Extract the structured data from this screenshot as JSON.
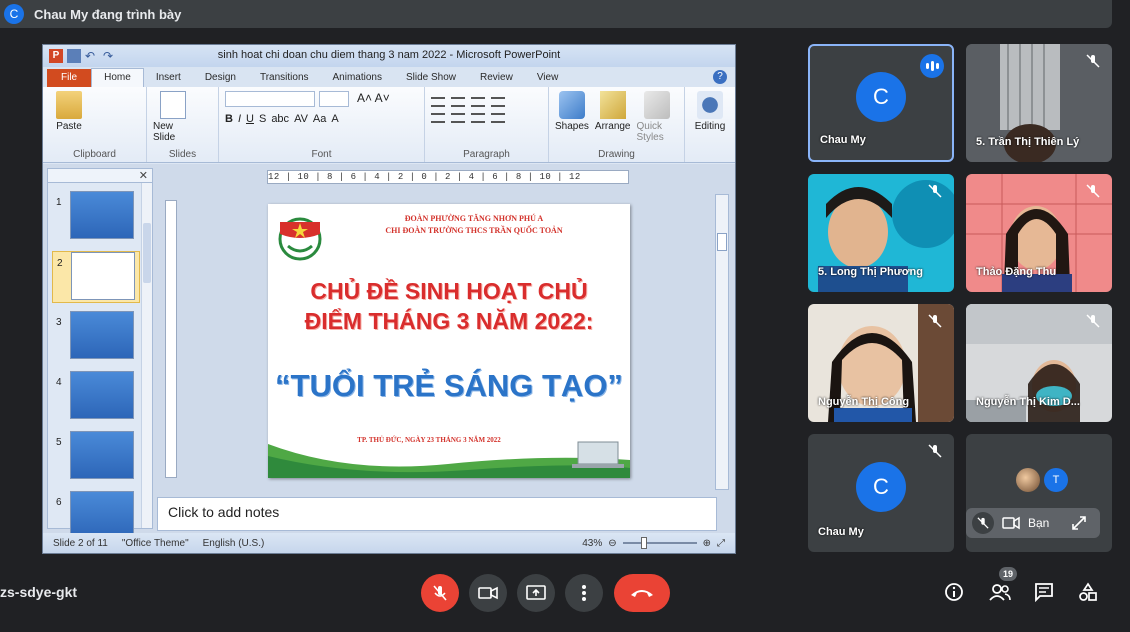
{
  "presenter_bar": {
    "avatar_letter": "C",
    "text": "Chau My đang trình bày"
  },
  "ppt": {
    "window_title": "sinh hoat chi doan chu diem thang 3 nam 2022  -  Microsoft PowerPoint",
    "tabs": [
      "File",
      "Home",
      "Insert",
      "Design",
      "Transitions",
      "Animations",
      "Slide Show",
      "Review",
      "View"
    ],
    "active_tab": "Home",
    "groups": {
      "clipboard": "Clipboard",
      "paste": "Paste",
      "slides": "Slides",
      "new_slide": "New Slide",
      "font": "Font",
      "paragraph": "Paragraph",
      "drawing": "Drawing",
      "shapes": "Shapes",
      "arrange": "Arrange",
      "quick_styles": "Quick Styles",
      "editing": "Editing"
    },
    "ruler_text": "12 | 10 | 8 | 6 | 4 | 2 | 0 | 2 | 4 | 6 | 8 | 10 | 12",
    "thumbnails": [
      "1",
      "2",
      "3",
      "4",
      "5",
      "6"
    ],
    "selected_slide": 2,
    "slide": {
      "org_line1": "ĐOÀN PHƯỜNG TĂNG NHƠN PHÚ A",
      "org_line2": "CHI ĐOÀN TRƯỜNG THCS TRẦN QUỐC TOẢN",
      "title_line1": "CHỦ ĐỀ SINH HOẠT CHỦ",
      "title_line2": "ĐIỂM THÁNG 3 NĂM 2022:",
      "theme": "“TUỔI TRẺ SÁNG TẠO”",
      "date_line": "TP. THỦ ĐỨC, NGÀY 23 THÁNG 3 NĂM 2022"
    },
    "notes_placeholder": "Click to add notes",
    "status": {
      "slide_info": "Slide 2 of 11",
      "theme": "\"Office Theme\"",
      "language": "English (U.S.)",
      "zoom": "43%"
    }
  },
  "participants": [
    {
      "name": "Chau My",
      "avatar": "C",
      "speaking": true
    },
    {
      "name": "5. Trần Thị Thiên Lý",
      "muted": true
    },
    {
      "name": "5. Long Thị Phương",
      "muted": true
    },
    {
      "name": "Thảo Đặng Thu",
      "muted": true
    },
    {
      "name": "Nguyễn Thị Công",
      "muted": true
    },
    {
      "name": "Nguyễn Thị Kim D...",
      "muted": true
    },
    {
      "name": "Chau My",
      "avatar": "C",
      "muted": true
    }
  ],
  "you_tile": {
    "label": "Bạn",
    "extra_avatar": "T"
  },
  "meeting_code": "zs-sdye-gkt",
  "participant_count": "19",
  "colors": {
    "end_call": "#ea4335",
    "accent": "#1a73e8",
    "ppt_file_tab": "#d24b1f"
  }
}
